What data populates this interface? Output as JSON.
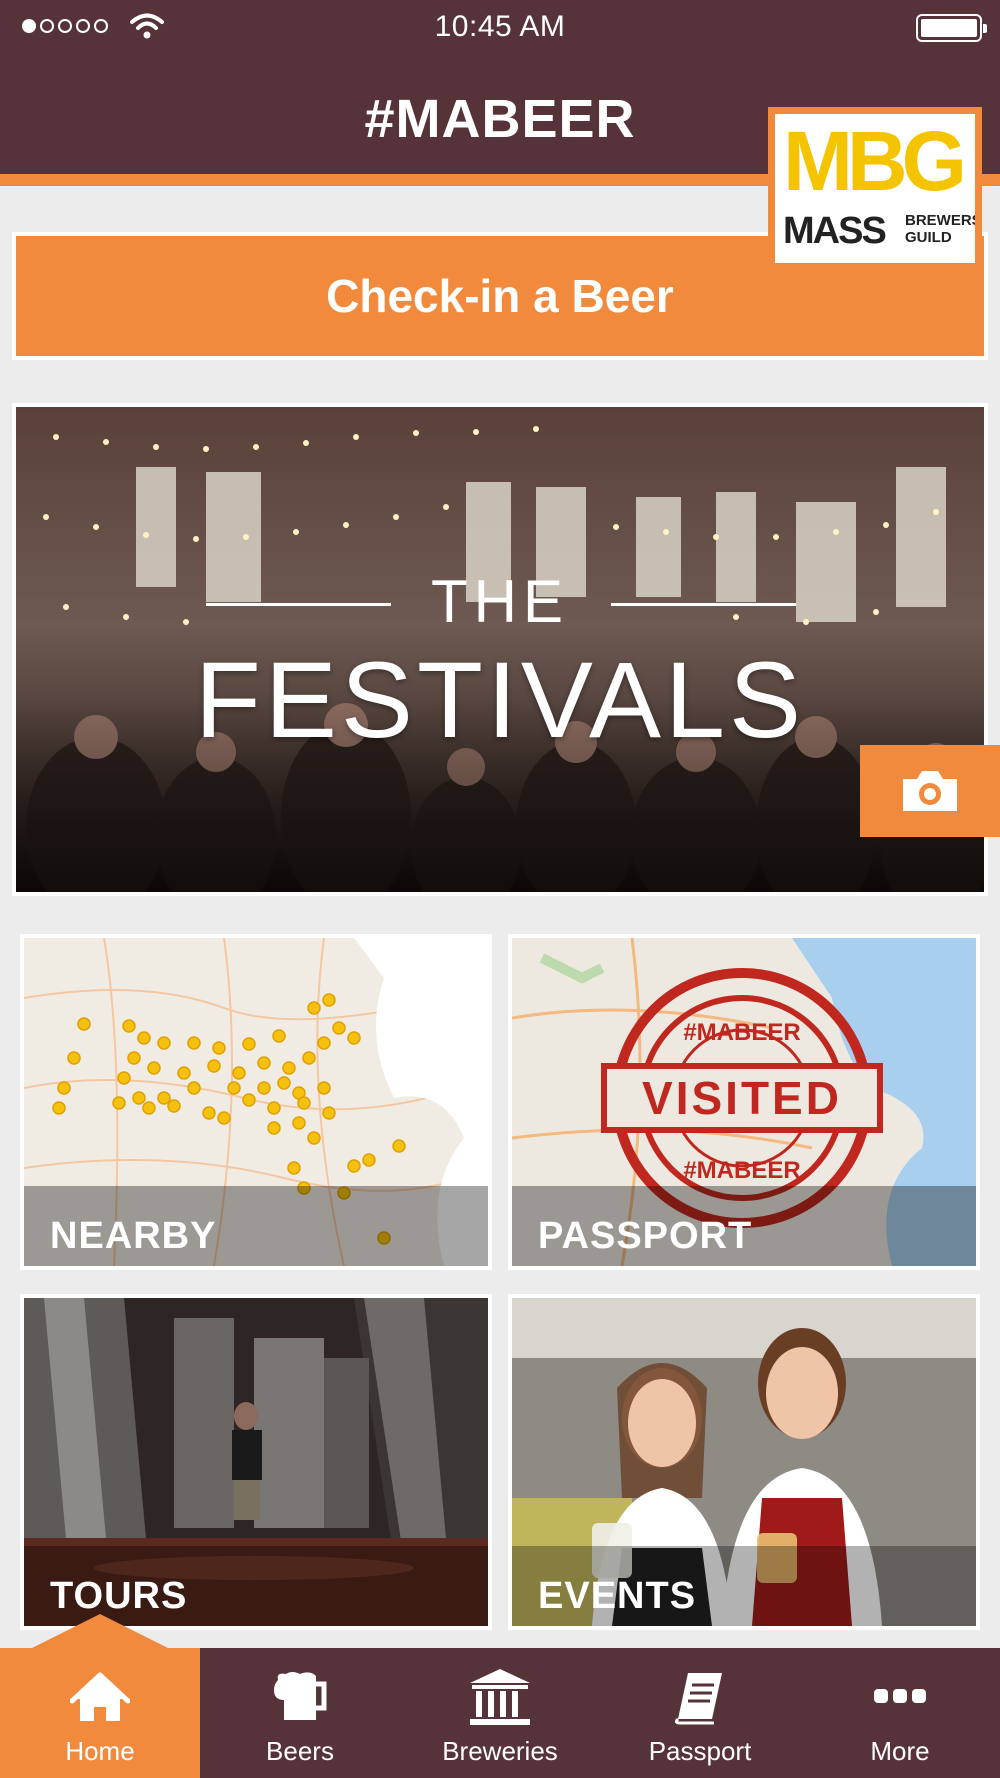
{
  "status_bar": {
    "time": "10:45 AM",
    "signal_bars_filled": 1,
    "signal_bars_total": 5,
    "wifi_icon": "wifi-icon",
    "battery_icon": "battery-icon"
  },
  "header": {
    "title": "#MABEER"
  },
  "logo": {
    "letters": "MBG",
    "line1": "MASS",
    "line2a": "BREWERS",
    "line2b": "GUILD"
  },
  "checkin": {
    "label": "Check-in a Beer"
  },
  "hero": {
    "title_top": "THE",
    "title_main": "FESTIVALS",
    "camera_icon": "camera-icon"
  },
  "tiles": [
    {
      "label": "NEARBY"
    },
    {
      "label": "PASSPORT",
      "stamp_top": "#MABEER",
      "stamp_main": "VISITED",
      "stamp_bottom": "#MABEER"
    },
    {
      "label": "TOURS"
    },
    {
      "label": "EVENTS"
    }
  ],
  "tabbar": {
    "items": [
      {
        "label": "Home",
        "icon": "home-icon",
        "active": true
      },
      {
        "label": "Beers",
        "icon": "beer-mug-icon",
        "active": false
      },
      {
        "label": "Breweries",
        "icon": "building-columns-icon",
        "active": false
      },
      {
        "label": "Passport",
        "icon": "book-icon",
        "active": false
      },
      {
        "label": "More",
        "icon": "more-dots-icon",
        "active": false
      }
    ]
  },
  "colors": {
    "header_bg": "#563338",
    "accent": "#f18a3c",
    "page_bg": "#ececec",
    "logo_yellow": "#f5c400",
    "stamp_red": "#c0281f"
  }
}
